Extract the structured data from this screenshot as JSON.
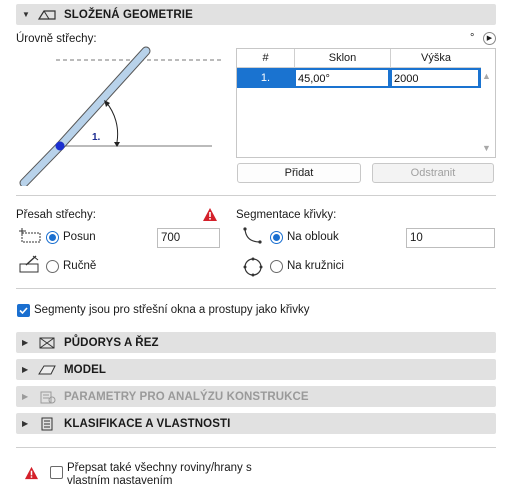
{
  "composite_section": {
    "title": "SLOŽENÁ GEOMETRIE",
    "icon": "composite-roof-icon",
    "roof_levels_label": "Úrovně střechy:",
    "degree_symbol": "°",
    "diagram_level_label": "1.",
    "table": {
      "headers": [
        "#",
        "Sklon",
        "Výška"
      ],
      "rows": [
        {
          "num": "1.",
          "pitch": "45,00°",
          "height": "2000"
        }
      ]
    },
    "add_button": "Přidat",
    "remove_button": "Odstranit"
  },
  "overhang": {
    "label": "Přesah střechy:",
    "options": [
      {
        "label": "Posun",
        "selected": true,
        "icon": "offset-icon"
      },
      {
        "label": "Ručně",
        "selected": false,
        "icon": "manual-icon"
      }
    ],
    "offset_value": "700"
  },
  "segmentation": {
    "label": "Segmentace křivky:",
    "options": [
      {
        "label": "Na oblouk",
        "selected": true,
        "icon": "arc-icon"
      },
      {
        "label": "Na kružnici",
        "selected": false,
        "icon": "circle-icon"
      }
    ],
    "value": "10"
  },
  "segments_checkbox": {
    "label": "Segmenty jsou pro střešní okna a prostupy jako křivky",
    "checked": true
  },
  "sections": [
    {
      "title": "PŮDORYS A ŘEZ",
      "icon": "floor-plan-icon",
      "disabled": false
    },
    {
      "title": "MODEL",
      "icon": "model-icon",
      "disabled": false
    },
    {
      "title": "PARAMETRY PRO ANALÝZU KONSTRUKCE",
      "icon": "structural-analysis-icon",
      "disabled": true
    },
    {
      "title": "KLASIFIKACE A VLASTNOSTI",
      "icon": "classification-icon",
      "disabled": false
    }
  ],
  "override": {
    "label_line1": "Přepsat také všechny roviny/hrany s",
    "label_line2": "vlastním nastavením",
    "checked": false
  },
  "colors": {
    "accent": "#1a73d0",
    "header_bg": "#e1e1e1",
    "warning": "#d4202a"
  }
}
